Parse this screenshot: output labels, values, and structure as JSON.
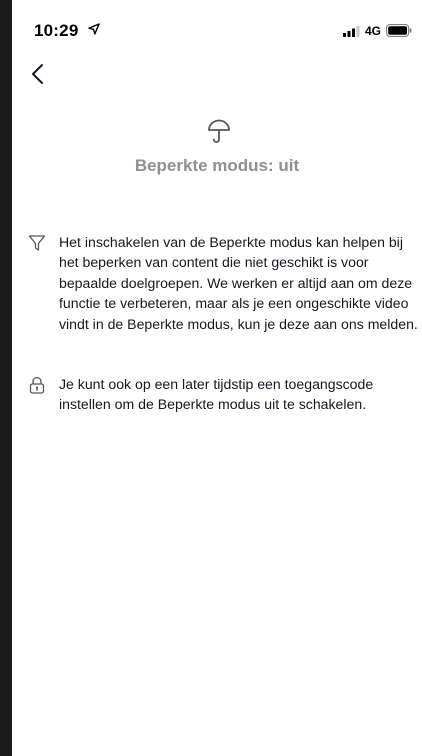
{
  "status_bar": {
    "time": "10:29",
    "network": "4G",
    "icons": [
      "location-arrow-icon",
      "signal-icon",
      "battery-icon"
    ]
  },
  "nav": {
    "back_icon": "chevron-left-icon"
  },
  "header": {
    "icon": "umbrella-icon",
    "title": "Beperkte modus: uit"
  },
  "info_items": [
    {
      "icon": "filter-icon",
      "text": "Het inschakelen van de Beperkte modus kan helpen bij het beperken van content die niet geschikt is voor bepaalde doelgroepen. We werken er altijd aan om deze functie te verbeteren, maar als je een ongeschikte video vindt in de Beperkte modus, kun je deze aan ons melden."
    },
    {
      "icon": "lock-icon",
      "text": "Je kunt ook op een later tijdstip een toegangscode instellen om de Beperkte modus uit te schakelen."
    }
  ],
  "colors": {
    "accent": "#fe2c55",
    "title_gray": "#8f8f95",
    "text": "#161823",
    "icon_gray": "#55565e"
  }
}
